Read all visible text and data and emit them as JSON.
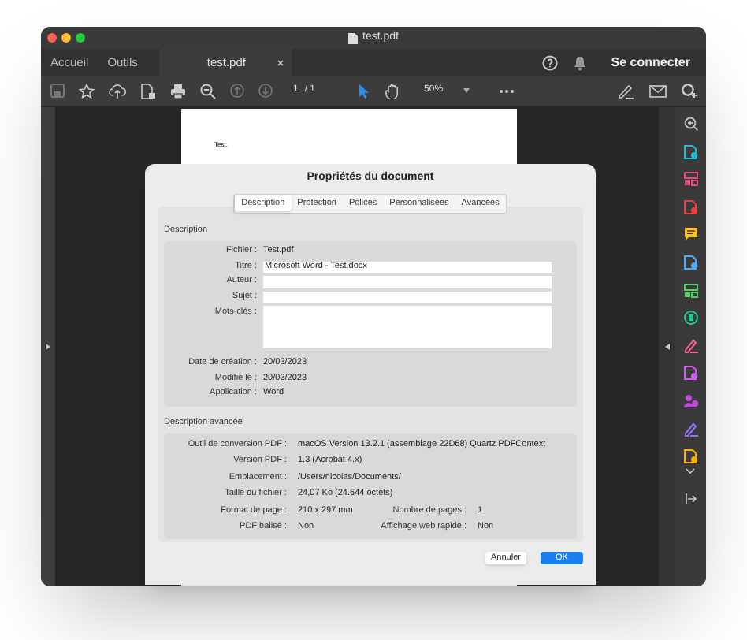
{
  "window": {
    "title": "test.pdf"
  },
  "nav_tabs": [
    {
      "label": "Accueil",
      "selected": false
    },
    {
      "label": "Outils",
      "selected": false
    },
    {
      "label": "test.pdf",
      "selected": true
    }
  ],
  "account": {
    "label": "Se connecter"
  },
  "toolbar": {
    "page": "1",
    "page_total": "/ 1",
    "zoom": "50%"
  },
  "document": {
    "text": "Test."
  },
  "dialog": {
    "title": "Propriétés du document",
    "tabs": [
      {
        "label": "Description",
        "selected": true
      },
      {
        "label": "Protection",
        "selected": false
      },
      {
        "label": "Polices",
        "selected": false
      },
      {
        "label": "Personnalisées",
        "selected": false
      },
      {
        "label": "Avancées",
        "selected": false
      }
    ],
    "description": {
      "heading": "Description",
      "rows": [
        {
          "kind": "text",
          "label": "Fichier :",
          "value": "Test.pdf"
        },
        {
          "kind": "field",
          "label": "Titre :",
          "value": "Microsoft Word - Test.docx"
        },
        {
          "kind": "field",
          "label": "Auteur :"
        },
        {
          "kind": "field",
          "label": "Sujet :"
        },
        {
          "kind": "area",
          "label": "Mots-clés :"
        },
        {
          "kind": "text",
          "label": "Date de création :",
          "value": "20/03/2023"
        },
        {
          "kind": "text",
          "label": "Modifié le :",
          "value": "20/03/2023"
        },
        {
          "kind": "text",
          "label": "Application :",
          "value": "Word"
        }
      ]
    },
    "advanced": {
      "heading": "Description avancée",
      "rows": [
        {
          "label": "Outil de conversion PDF :",
          "value": "macOS Version 13.2.1 (assemblage 22D68) Quartz PDFContext"
        },
        {
          "label": "Version PDF :",
          "value": "1.3 (Acrobat 4.x)"
        },
        {
          "label": "Emplacement :",
          "value": "/Users/nicolas/Documents/"
        },
        {
          "label": "Taille du fichier :",
          "value": "24,07 Ko (24.644 octets)"
        },
        {
          "label": "Format de page :",
          "value": "210 x 297 mm",
          "label_2": "Nombre de pages :",
          "value_2": "1"
        },
        {
          "label": "PDF balisé :",
          "value": "Non",
          "label_2": "Affichage web rapide :",
          "value_2": "Non"
        }
      ]
    },
    "buttons": [
      {
        "label": "Annuler",
        "kind": "secondary"
      },
      {
        "label": "OK",
        "kind": "primary"
      }
    ]
  }
}
